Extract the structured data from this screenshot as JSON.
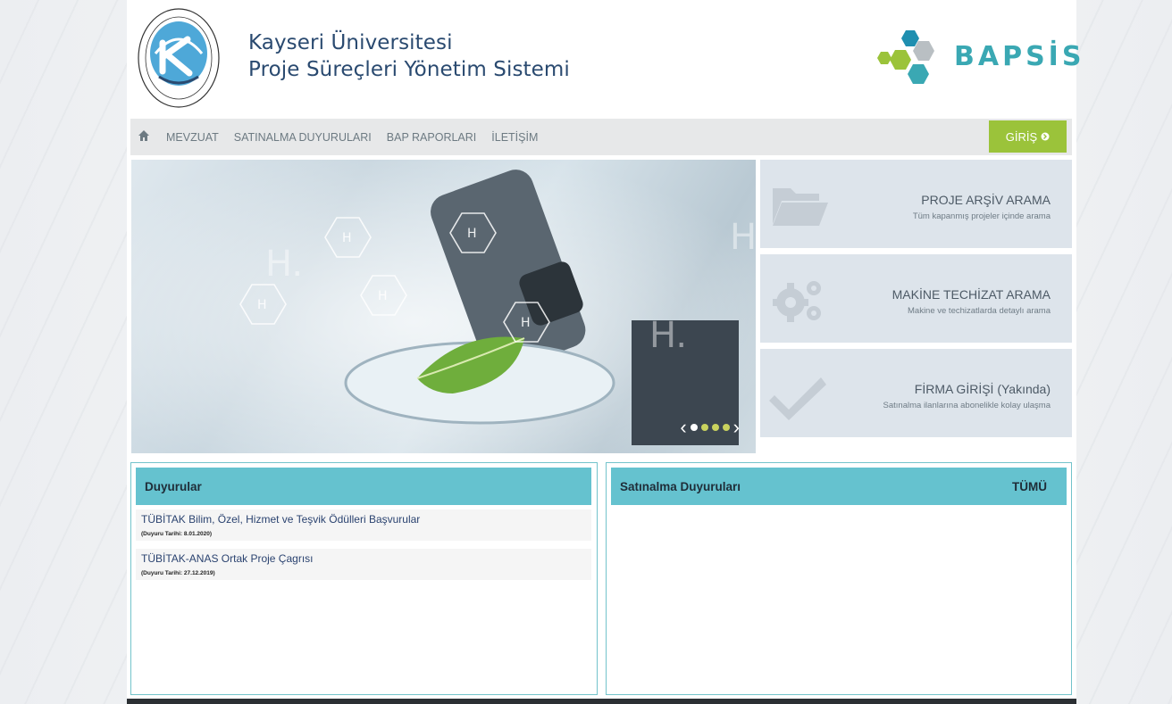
{
  "header": {
    "title_line1": "Kayseri Üniversitesi",
    "title_line2": "Proje Süreçleri Yönetim Sistemi",
    "brand": "BAPSİS",
    "logo_text": "KAYSERİ ÜNİVERSİTESİ"
  },
  "nav": {
    "items": [
      "MEVZUAT",
      "SATINALMA DUYURULARI",
      "BAP RAPORLARI",
      "İLETİŞİM"
    ],
    "login_label": "GİRİŞ"
  },
  "slider": {
    "prev_icon": "chevron-left-icon",
    "next_icon": "chevron-right-icon",
    "dots": 4,
    "active_dot": 1
  },
  "quick_links": [
    {
      "title": "PROJE ARŞİV ARAMA",
      "subtitle": "Tüm kapanmış projeler içinde arama",
      "icon": "folder-open-icon"
    },
    {
      "title": "MAKİNE TECHİZAT ARAMA",
      "subtitle": "Makine ve techizatlarda detaylı arama",
      "icon": "gears-icon"
    },
    {
      "title": "FİRMA GİRİŞİ (Yakında)",
      "subtitle": "Satınalma ilanlarına abonelikle kolay ulaşma",
      "icon": "check-icon"
    }
  ],
  "announcements": {
    "heading": "Duyurular",
    "items": [
      {
        "title": "TÜBİTAK Bilim, Özel, Hizmet ve Teşvik Ödülleri Başvurular",
        "date": "(Duyuru Tarihi: 8.01.2020)"
      },
      {
        "title": "TÜBİTAK-ANAS Ortak Proje Çagrısı",
        "date": "(Duyuru Tarihi: 27.12.2019)"
      }
    ]
  },
  "procurement": {
    "heading": "Satınalma Duyuruları",
    "all_label": "TÜMÜ"
  },
  "colors": {
    "accent_teal": "#65c2cf",
    "login_green": "#9bc33a",
    "title_blue": "#2a4a70"
  }
}
